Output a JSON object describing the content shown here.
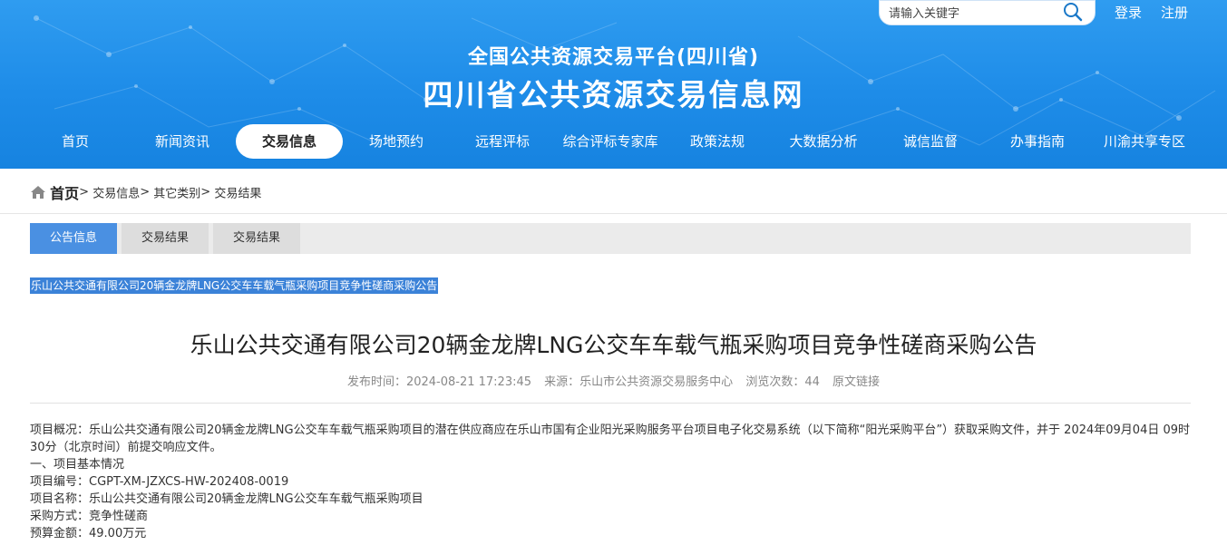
{
  "search": {
    "placeholder": "请输入关键字"
  },
  "auth": {
    "login": "登录",
    "register": "注册"
  },
  "header": {
    "subtitle": "全国公共资源交易平台(四川省)",
    "title": "四川省公共资源交易信息网"
  },
  "nav": [
    {
      "label": "首页"
    },
    {
      "label": "新闻资讯"
    },
    {
      "label": "交易信息"
    },
    {
      "label": "场地预约"
    },
    {
      "label": "远程评标"
    },
    {
      "label": "综合评标专家库"
    },
    {
      "label": "政策法规"
    },
    {
      "label": "大数据分析"
    },
    {
      "label": "诚信监督"
    },
    {
      "label": "办事指南"
    },
    {
      "label": "川渝共享专区"
    }
  ],
  "breadcrumb": {
    "home": "首页",
    "items": [
      "交易信息",
      "其它类别",
      "交易结果"
    ],
    "sep": ">"
  },
  "tabs": [
    {
      "label": "公告信息"
    },
    {
      "label": "交易结果"
    },
    {
      "label": "交易结果"
    }
  ],
  "highlight_title": "乐山公共交通有限公司20辆金龙牌LNG公交车车载气瓶采购项目竞争性磋商采购公告",
  "article": {
    "title": "乐山公共交通有限公司20辆金龙牌LNG公交车车载气瓶采购项目竞争性磋商采购公告",
    "publish": "发布时间：2024-08-21 17:23:45",
    "source": "来源：乐山市公共资源交易服务中心",
    "views": "浏览次数：44",
    "origin_link": "原文链接",
    "paragraphs": [
      "项目概况：乐山公共交通有限公司20辆金龙牌LNG公交车车载气瓶采购项目的潜在供应商应在乐山市国有企业阳光采购服务平台项目电子化交易系统（以下简称“阳光采购平台”）获取采购文件，并于 2024年09月04日 09时30分（北京时间）前提交响应文件。",
      "一、项目基本情况",
      "项目编号：CGPT-XM-JZXCS-HW-202408-0019",
      "项目名称：乐山公共交通有限公司20辆金龙牌LNG公交车车载气瓶采购项目",
      "采购方式：竞争性磋商",
      "预算金额：49.00万元"
    ]
  }
}
